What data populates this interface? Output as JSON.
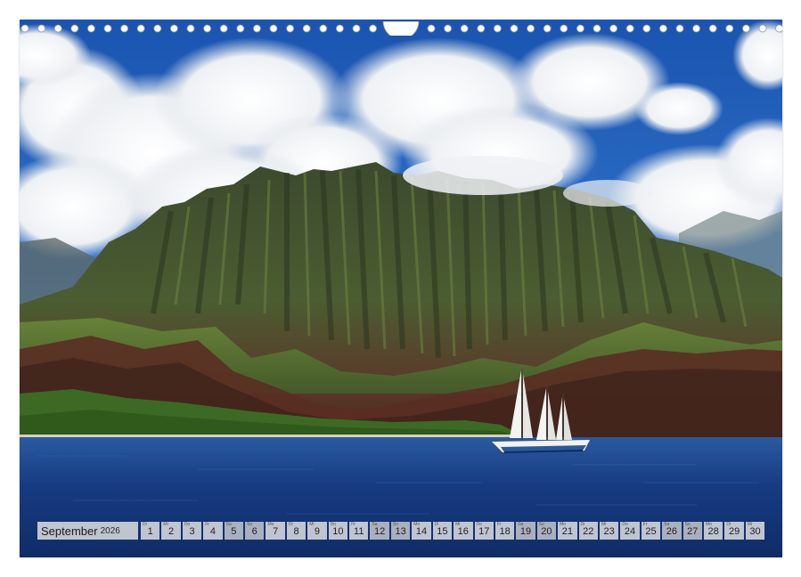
{
  "calendar": {
    "month": "September",
    "year": "2026",
    "days": [
      {
        "n": "1",
        "dow": "Di",
        "weekend": false
      },
      {
        "n": "2",
        "dow": "Mi",
        "weekend": false
      },
      {
        "n": "3",
        "dow": "Do",
        "weekend": false
      },
      {
        "n": "4",
        "dow": "Fr",
        "weekend": false
      },
      {
        "n": "5",
        "dow": "Sa",
        "weekend": true
      },
      {
        "n": "6",
        "dow": "So",
        "weekend": true
      },
      {
        "n": "7",
        "dow": "Mo",
        "weekend": false
      },
      {
        "n": "8",
        "dow": "Di",
        "weekend": false
      },
      {
        "n": "9",
        "dow": "Mi",
        "weekend": false
      },
      {
        "n": "10",
        "dow": "Do",
        "weekend": false
      },
      {
        "n": "11",
        "dow": "Fr",
        "weekend": false
      },
      {
        "n": "12",
        "dow": "Sa",
        "weekend": true
      },
      {
        "n": "13",
        "dow": "So",
        "weekend": true
      },
      {
        "n": "14",
        "dow": "Mo",
        "weekend": false
      },
      {
        "n": "15",
        "dow": "Di",
        "weekend": false
      },
      {
        "n": "16",
        "dow": "Mi",
        "weekend": false
      },
      {
        "n": "17",
        "dow": "Do",
        "weekend": false
      },
      {
        "n": "18",
        "dow": "Fr",
        "weekend": false
      },
      {
        "n": "19",
        "dow": "Sa",
        "weekend": true
      },
      {
        "n": "20",
        "dow": "So",
        "weekend": true
      },
      {
        "n": "21",
        "dow": "Mo",
        "weekend": false
      },
      {
        "n": "22",
        "dow": "Di",
        "weekend": false
      },
      {
        "n": "23",
        "dow": "Mi",
        "weekend": false
      },
      {
        "n": "24",
        "dow": "Do",
        "weekend": false
      },
      {
        "n": "25",
        "dow": "Fr",
        "weekend": false
      },
      {
        "n": "26",
        "dow": "Sa",
        "weekend": true
      },
      {
        "n": "27",
        "dow": "So",
        "weekend": true
      },
      {
        "n": "28",
        "dow": "Mo",
        "weekend": false
      },
      {
        "n": "29",
        "dow": "Di",
        "weekend": false
      },
      {
        "n": "30",
        "dow": "Mi",
        "weekend": false
      }
    ]
  },
  "colors": {
    "sky": "#1f5fb8",
    "cloud": "#f2f4f6",
    "mountain": "#3d4a2c",
    "sea": "#173a7a",
    "sail": "#f4f4f2"
  }
}
